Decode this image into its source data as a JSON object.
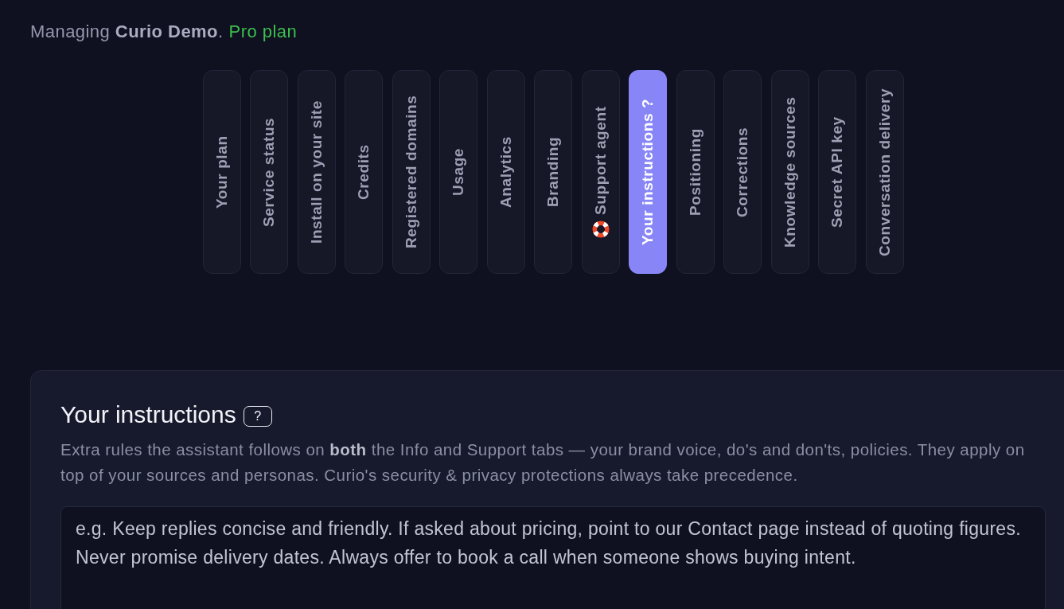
{
  "header": {
    "text": "Managing **Curio Demo**.",
    "plan": "Pro plan"
  },
  "tabs": [
    {
      "label": "Your plan",
      "selected": false,
      "kind": "plain"
    },
    {
      "label": "Service status",
      "selected": false,
      "kind": "plain"
    },
    {
      "label": "Install on your site",
      "selected": false,
      "kind": "plain"
    },
    {
      "label": "Credits",
      "selected": false,
      "kind": "plain"
    },
    {
      "label": "Registered domains",
      "selected": false,
      "kind": "plain"
    },
    {
      "label": "Usage",
      "selected": false,
      "kind": "plain"
    },
    {
      "label": "Analytics",
      "selected": false,
      "kind": "plain"
    },
    {
      "label": "Branding",
      "selected": false,
      "kind": "plain"
    },
    {
      "label": "Support agent",
      "selected": false,
      "kind": "lifebuoy"
    },
    {
      "label": "Your instructions ?",
      "selected": true,
      "kind": "plain"
    },
    {
      "label": "Positioning",
      "selected": false,
      "kind": "plain"
    },
    {
      "label": "Corrections",
      "selected": false,
      "kind": "plain"
    },
    {
      "label": "Knowledge sources",
      "selected": false,
      "kind": "plain"
    },
    {
      "label": "Secret API key",
      "selected": false,
      "kind": "plain"
    },
    {
      "label": "Conversation delivery",
      "selected": false,
      "kind": "plain"
    }
  ],
  "panel": {
    "title": "Your instructions",
    "help": "?",
    "description": "Extra rules the assistant follows on **both** the Info and Support tabs — your brand voice, do's and don'ts, policies. They apply on top of your sources and personas. Curio's security & privacy protections always take precedence.",
    "input": {
      "placeholder": "e.g. Keep replies concise and friendly. If asked about pricing, point to our Contact page instead of quoting figures. Never promise delivery dates. Always offer to book a call when someone shows buying intent."
    }
  }
}
